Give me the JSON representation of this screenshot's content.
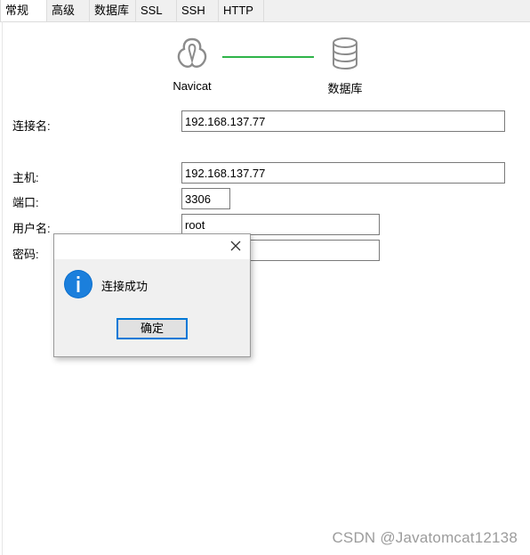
{
  "tabs": [
    {
      "label": "常规",
      "active": true
    },
    {
      "label": "高级",
      "active": false
    },
    {
      "label": "数据库",
      "active": false
    },
    {
      "label": "SSL",
      "active": false
    },
    {
      "label": "SSH",
      "active": false
    },
    {
      "label": "HTTP",
      "active": false
    }
  ],
  "diagram": {
    "left_label": "Navicat",
    "right_label": "数据库",
    "link_color": "#2fb44a"
  },
  "form": {
    "connection_name_label": "连接名:",
    "connection_name_value": "192.168.137.77",
    "host_label": "主机:",
    "host_value": "192.168.137.77",
    "port_label": "端口:",
    "port_value": "3306",
    "username_label": "用户名:",
    "username_value": "root",
    "password_label": "密码:",
    "password_value": ""
  },
  "dialog": {
    "message": "连接成功",
    "ok_label": "确定",
    "icon": "info-icon",
    "accent_color": "#0078d7"
  },
  "watermark": "CSDN @Javatomcat12138"
}
